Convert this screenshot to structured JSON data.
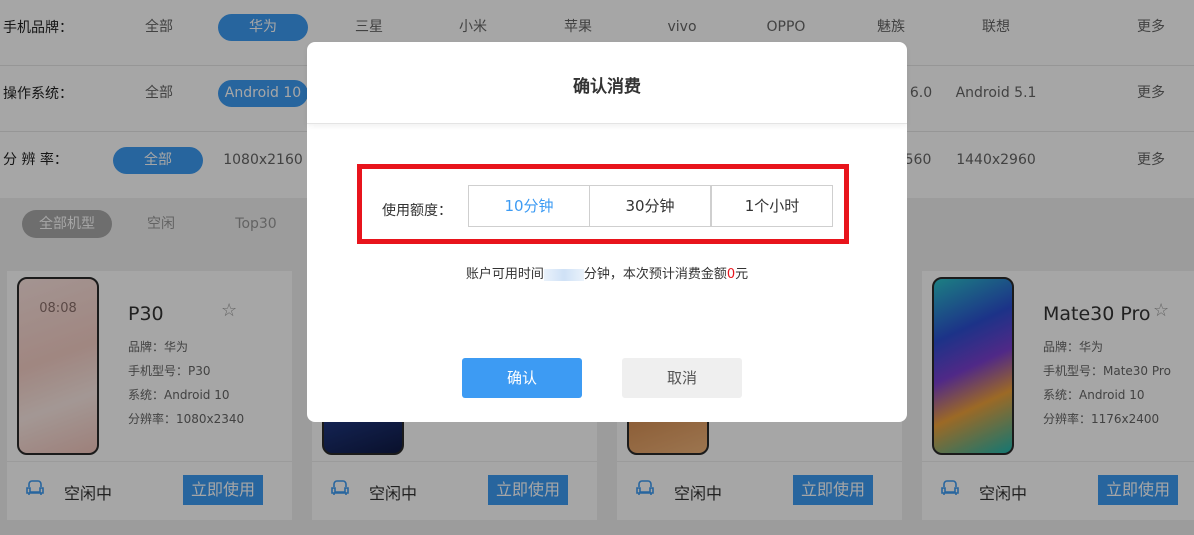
{
  "filters": {
    "brand": {
      "label": "手机品牌：",
      "options": [
        "全部",
        "华为",
        "三星",
        "小米",
        "苹果",
        "vivo",
        "OPPO",
        "魅族",
        "联想",
        "更多"
      ]
    },
    "os": {
      "label": "操作系统：",
      "options": [
        "全部",
        "Android 10",
        "6.0",
        "Android 5.1",
        "更多"
      ]
    },
    "resolution": {
      "label": "分 辨 率：",
      "options": [
        "全部",
        "1080x2160",
        "560",
        "1440x2960",
        "更多"
      ]
    }
  },
  "subtabs": [
    "全部机型",
    "空闲",
    "Top30"
  ],
  "cards": [
    {
      "name": "P30",
      "brand": "品牌：华为",
      "model": "手机型号：P30",
      "system": "系统：Android 10",
      "resolution": "分辨率：1080x2340",
      "status": "空闲中",
      "use_label": "立即使用",
      "phone_time": "08:08"
    },
    {
      "status": "空闲中",
      "use_label": "立即使用"
    },
    {
      "status": "空闲中",
      "use_label": "立即使用"
    },
    {
      "name": "Mate30 Pro",
      "brand": "品牌：华为",
      "model": "手机型号：Mate30 Pro",
      "system": "系统：Android 10",
      "resolution": "分辨率：1176x2400",
      "status": "空闲中",
      "use_label": "立即使用"
    }
  ],
  "modal": {
    "title": "确认消费",
    "quota_label": "使用额度：",
    "options": [
      "10分钟",
      "30分钟",
      "1个小时"
    ],
    "selected": "10分钟",
    "info_prefix": "账户可用时间",
    "info_mid": "分钟，本次预计消费金额",
    "info_amount": "0",
    "info_suffix": "元",
    "confirm_label": "确认",
    "cancel_label": "取消"
  },
  "colors": {
    "accent": "#3d9bf3",
    "highlight_box": "#e8141c",
    "overlay": "rgba(0,0,0,0.35)"
  }
}
